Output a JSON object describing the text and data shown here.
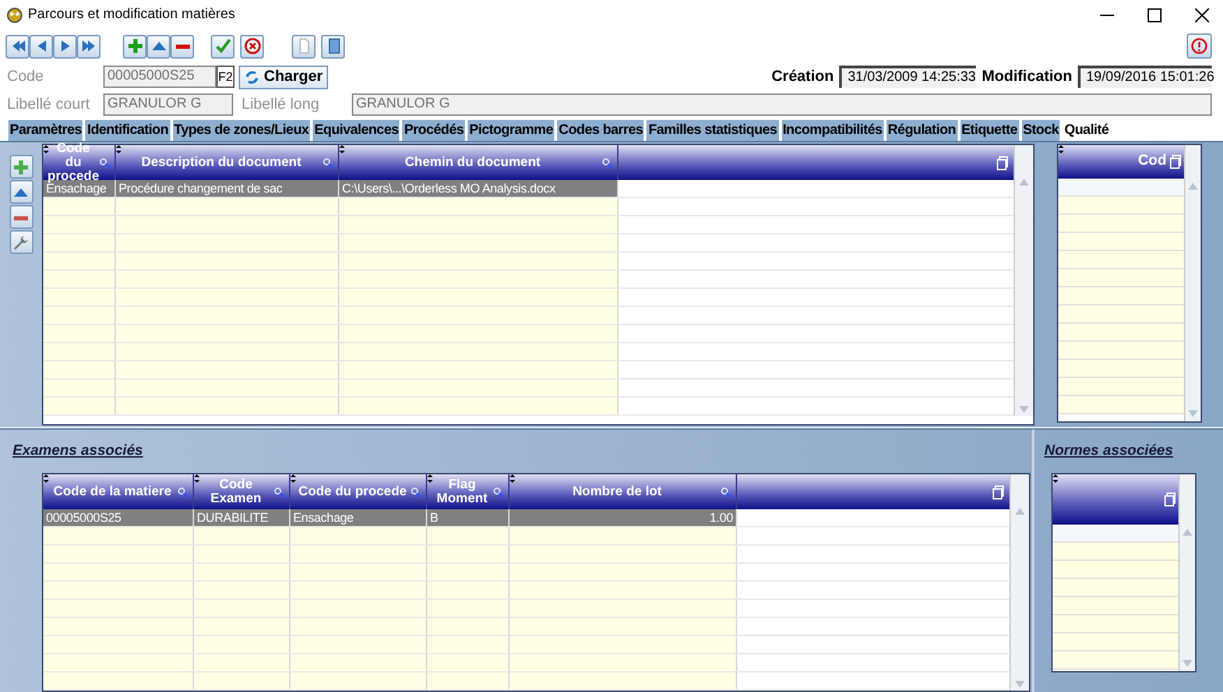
{
  "window": {
    "title": "Parcours et modification matières"
  },
  "code": {
    "label": "Code",
    "value": "00005000S25",
    "key": "F2",
    "load_button": "Charger"
  },
  "creation": {
    "label": "Création",
    "value": "31/03/2009 14:25:33"
  },
  "modification": {
    "label": "Modification",
    "value": "19/09/2016 15:01:26"
  },
  "short_label": {
    "label": "Libellé court",
    "value": "GRANULOR G"
  },
  "long_label": {
    "label": "Libellé long",
    "value": "GRANULOR G"
  },
  "tabs": [
    {
      "label": "Paramètres",
      "selected": false
    },
    {
      "label": "Identification",
      "selected": false
    },
    {
      "label": "Types de zones/Lieux",
      "selected": false
    },
    {
      "label": "Equivalences",
      "selected": false
    },
    {
      "label": "Procédés",
      "selected": false
    },
    {
      "label": "Pictogramme",
      "selected": false
    },
    {
      "label": "Codes barres",
      "selected": false
    },
    {
      "label": "Familles statistiques",
      "selected": false
    },
    {
      "label": "Incompatibilités",
      "selected": false
    },
    {
      "label": "Régulation",
      "selected": false
    },
    {
      "label": "Etiquette",
      "selected": false
    },
    {
      "label": "Stock",
      "selected": false
    },
    {
      "label": "Qualité",
      "selected": true
    }
  ],
  "documents_table": {
    "columns": [
      "Code du procede",
      "Description du document",
      "Chemin du document"
    ],
    "rows": [
      {
        "cells": [
          "Ensachage",
          "Procédure changement de sac",
          "C:\\Users\\...\\Orderless MO Analysis.docx"
        ],
        "selected": true
      }
    ]
  },
  "side_table": {
    "columns": [
      "Cod"
    ]
  },
  "exams": {
    "title": "Examens associés",
    "columns": [
      "Code de la matiere",
      "Code Examen",
      "Code du procede",
      "Flag Moment",
      "Nombre de lot"
    ],
    "rows": [
      {
        "cells": [
          "00005000S25",
          "DURABILITE",
          "Ensachage",
          "B",
          "1.00"
        ],
        "selected": true
      }
    ]
  },
  "norms": {
    "title": "Normes associées"
  }
}
